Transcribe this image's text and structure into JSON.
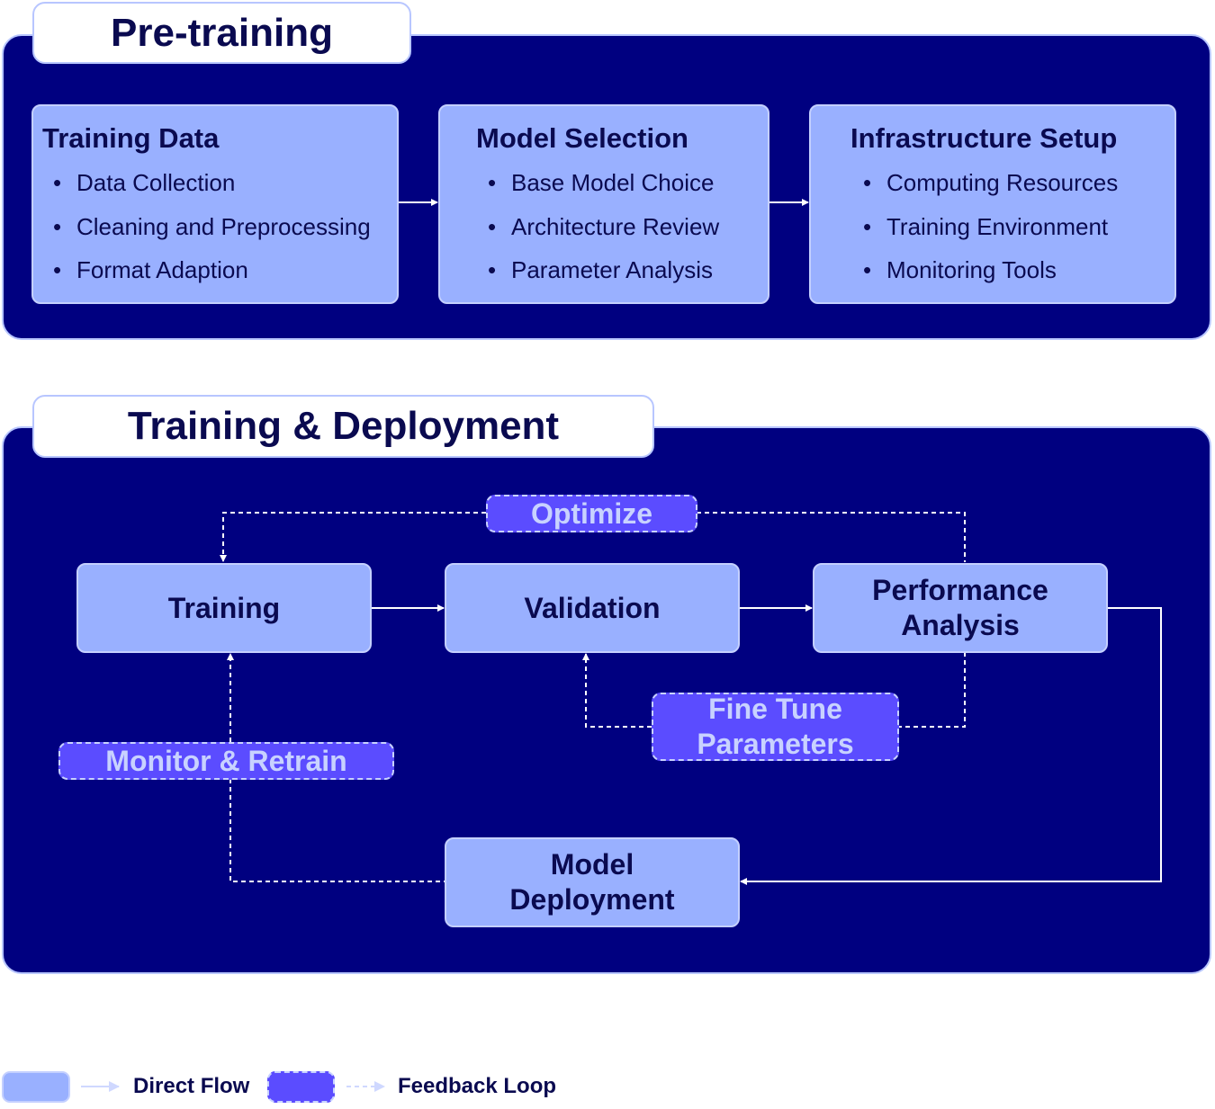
{
  "pretraining": {
    "title": "Pre-training",
    "cards": [
      {
        "title": "Training Data",
        "items": [
          "Data Collection",
          "Cleaning and Preprocessing",
          "Format Adaption"
        ]
      },
      {
        "title": "Model Selection",
        "items": [
          "Base Model Choice",
          "Architecture Review",
          "Parameter Analysis"
        ]
      },
      {
        "title": "Infrastructure Setup",
        "items": [
          "Computing Resources",
          "Training Environment",
          "Monitoring Tools"
        ]
      }
    ]
  },
  "deployment": {
    "title": "Training & Deployment",
    "nodes": {
      "training": "Training",
      "validation": "Validation",
      "performance_1": "Performance",
      "performance_2": "Analysis",
      "deploy_1": "Model",
      "deploy_2": "Deployment"
    },
    "feedback": {
      "optimize": "Optimize",
      "fine_tune_1": "Fine Tune",
      "fine_tune_2": "Parameters",
      "monitor": "Monitor & Retrain"
    }
  },
  "legend": {
    "direct": "Direct Flow",
    "feedback": "Feedback Loop"
  },
  "colors": {
    "panel": "#000080",
    "node": "#99b0ff",
    "feedback": "#5b4cff",
    "text": "#0a0a50"
  }
}
